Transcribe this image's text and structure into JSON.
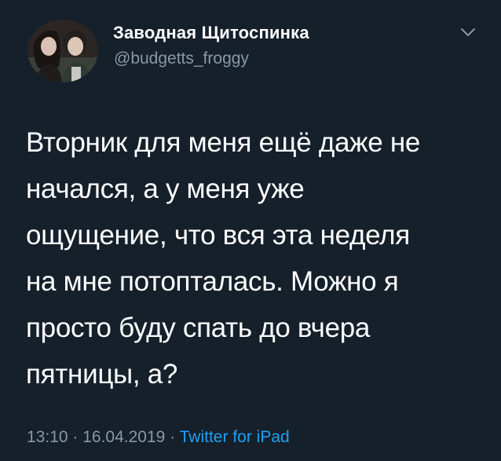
{
  "author": {
    "display_name": "Заводная Щитоспинка",
    "handle": "@budgetts_froggy"
  },
  "tweet": {
    "text": "Вторник для меня ещё даже не\nначался, а у меня уже\nощущение, что вся эта неделя\nна мне потопталась. Можно я\nпросто буду спать до вчера\nпятницы, а?"
  },
  "meta": {
    "time": "13:10",
    "separator_1": " · ",
    "date": "16.04.2019",
    "separator_2": " · ",
    "source": "Twitter for iPad"
  },
  "icons": {
    "more": "chevron-down-icon"
  },
  "colors": {
    "background": "#15202b",
    "text": "#ffffff",
    "secondary": "#8899a6",
    "link": "#1da1f2"
  }
}
